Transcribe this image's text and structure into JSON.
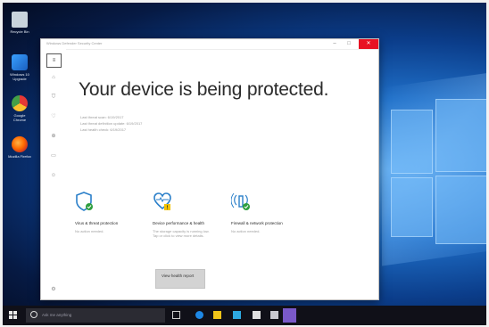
{
  "desktop": {
    "icons": [
      {
        "label": "Recycle Bin",
        "icon": "recycle-bin-icon"
      },
      {
        "label": "Windows 10 Upgrade",
        "icon": "windows-upgrade-icon"
      },
      {
        "label": "Google Chrome",
        "icon": "chrome-icon"
      },
      {
        "label": "Mozilla Firefox",
        "icon": "firefox-icon"
      }
    ]
  },
  "window": {
    "title": "Windows Defender Security Center",
    "controls": {
      "minimize": "–",
      "maximize": "□",
      "close": "✕"
    }
  },
  "sidebar": {
    "menu": "≡",
    "items": [
      "⌂",
      "⛉",
      "♡",
      "⊕",
      "▭",
      "☺"
    ],
    "settings": "⚙"
  },
  "main": {
    "headline": "Your device is being protected.",
    "meta": [
      "Last threat scan: 6/19/2017",
      "Last threat definition update: 6/19/2017",
      "Last health check: 6/19/2017"
    ],
    "tiles": [
      {
        "title": "Virus & threat protection",
        "subtitle": "No action needed.",
        "icon": "shield-check-icon",
        "status_color": "#2e9e3e"
      },
      {
        "title": "Device performance & health",
        "subtitle": "The storage capacity is running low. Tap or click to view more details.",
        "icon": "heart-pulse-warning-icon",
        "status_color": "#f2c200"
      },
      {
        "title": "Firewall & network protection",
        "subtitle": "No action needed.",
        "icon": "wireless-check-icon",
        "status_color": "#2e9e3e"
      }
    ],
    "report_button": "View health report"
  },
  "taskbar": {
    "search_placeholder": "Ask me anything",
    "colors": {
      "accent": "#1e88e5",
      "bar": "#101018"
    }
  }
}
